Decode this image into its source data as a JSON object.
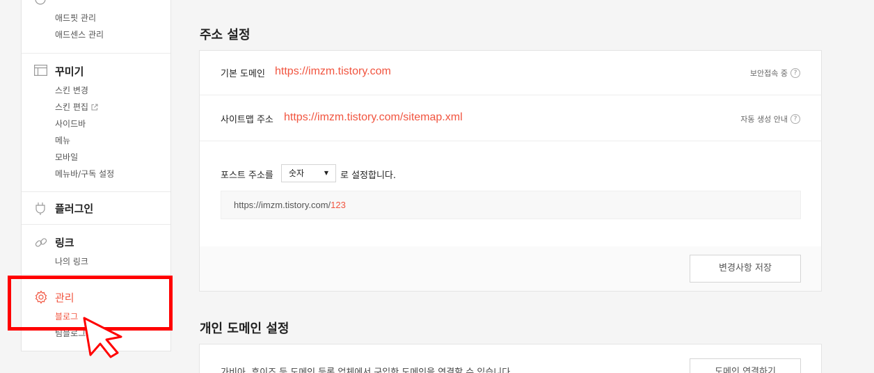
{
  "sidebar": {
    "ad": {
      "items": [
        "애드핏 관리",
        "애드센스 관리"
      ]
    },
    "design": {
      "title": "꾸미기",
      "items": [
        "스킨 변경",
        "스킨 편집",
        "사이드바",
        "메뉴",
        "모바일",
        "메뉴바/구독 설정"
      ]
    },
    "plugin": {
      "title": "플러그인"
    },
    "link": {
      "title": "링크",
      "items": [
        "나의 링크"
      ]
    },
    "manage": {
      "title": "관리",
      "items": [
        "블로그",
        "팀블로그"
      ]
    }
  },
  "address_settings": {
    "title": "주소 설정",
    "base_domain": {
      "label": "기본 도메인",
      "url": "https://imzm.tistory.com",
      "meta": "보안접속 중"
    },
    "sitemap": {
      "label": "사이트맵 주소",
      "url": "https://imzm.tistory.com/sitemap.xml",
      "meta": "자동 생성 안내"
    },
    "post_address": {
      "before": "포스트 주소를",
      "selected": "숫자",
      "after": "로 설정합니다.",
      "preview_prefix": "https://imzm.tistory.com/",
      "preview_num": "123"
    },
    "save_label": "변경사항 저장"
  },
  "personal_domain": {
    "title": "개인 도메인 설정",
    "description": "가비아, 후이즈 등 도메인 등록 업체에서 구입한 도메인을 연결할 수 있습니다.",
    "connect_label": "도메인 연결하기"
  },
  "colors": {
    "accent": "#f1543f",
    "highlight": "#ff0000"
  }
}
